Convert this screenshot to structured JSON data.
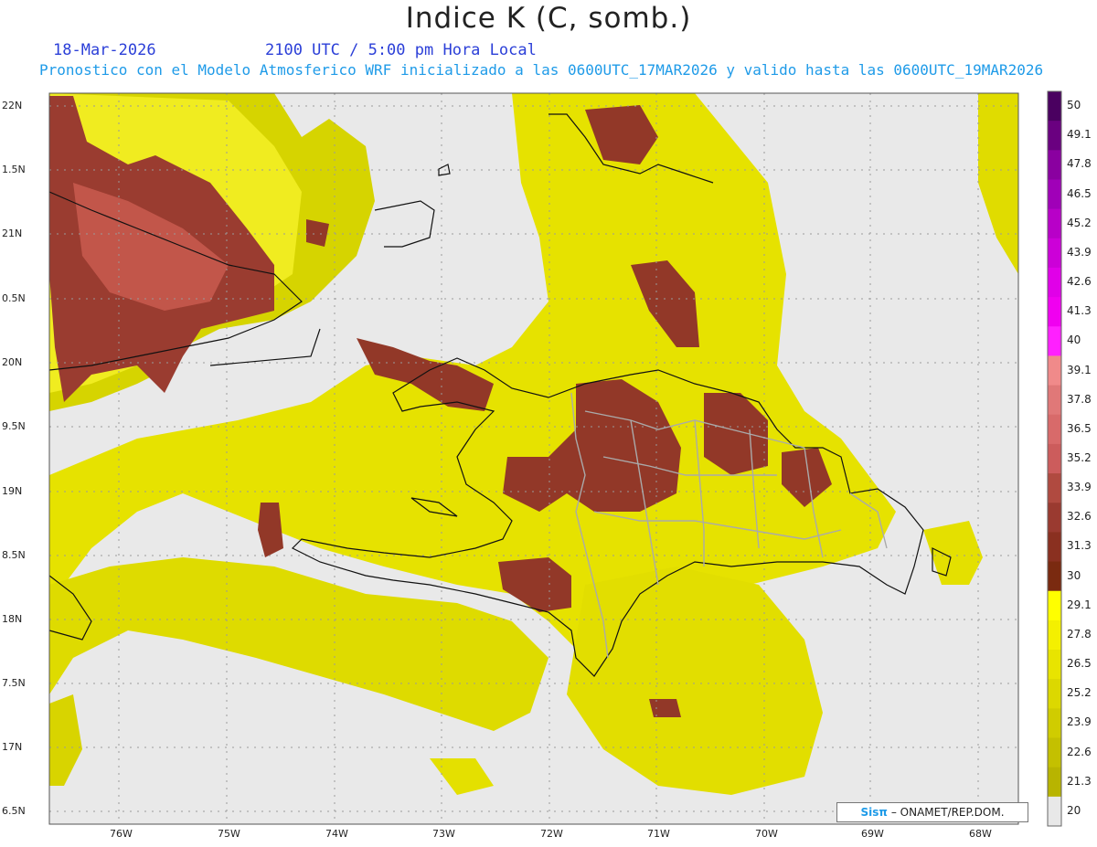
{
  "header": {
    "title": "Indice K (C, somb.)",
    "date": "18-Mar-2026",
    "time": "2100 UTC / 5:00 pm Hora Local",
    "forecast": "Pronostico con el Modelo Atmosferico WRF inicializado a las 0600UTC_17MAR2026 y valido hasta las  0600UTC_19MAR2026"
  },
  "axes": {
    "lat_labels": [
      "22N",
      "1.5N",
      "21N",
      "0.5N",
      "20N",
      "9.5N",
      "19N",
      "8.5N",
      "18N",
      "7.5N",
      "17N",
      "6.5N"
    ],
    "lon_labels": [
      "76W",
      "75W",
      "74W",
      "73W",
      "72W",
      "71W",
      "70W",
      "69W",
      "68W"
    ]
  },
  "legend": {
    "labels": [
      "50",
      "49.1",
      "47.8",
      "46.5",
      "45.2",
      "43.9",
      "42.6",
      "41.3",
      "40",
      "39.1",
      "37.8",
      "36.5",
      "35.2",
      "33.9",
      "32.6",
      "31.3",
      "30",
      "29.1",
      "27.8",
      "26.5",
      "25.2",
      "23.9",
      "22.6",
      "21.3",
      "20"
    ],
    "colors": [
      "#4a0060",
      "#6a0080",
      "#8a00a0",
      "#a000b8",
      "#b800c8",
      "#cc00d8",
      "#e000e8",
      "#f000f0",
      "#ff20ff",
      "#f08a8a",
      "#e07878",
      "#d86a6a",
      "#cc5c5c",
      "#b04a40",
      "#9a3a30",
      "#8a3020",
      "#7a2a10",
      "#ffff00",
      "#f4f000",
      "#e8e400",
      "#dcd800",
      "#d0cc00",
      "#c4c000",
      "#b8b400",
      "#e8e8e8"
    ]
  },
  "credit": {
    "logo": "Sisπ",
    "text": "– ONAMET/REP.DOM."
  }
}
